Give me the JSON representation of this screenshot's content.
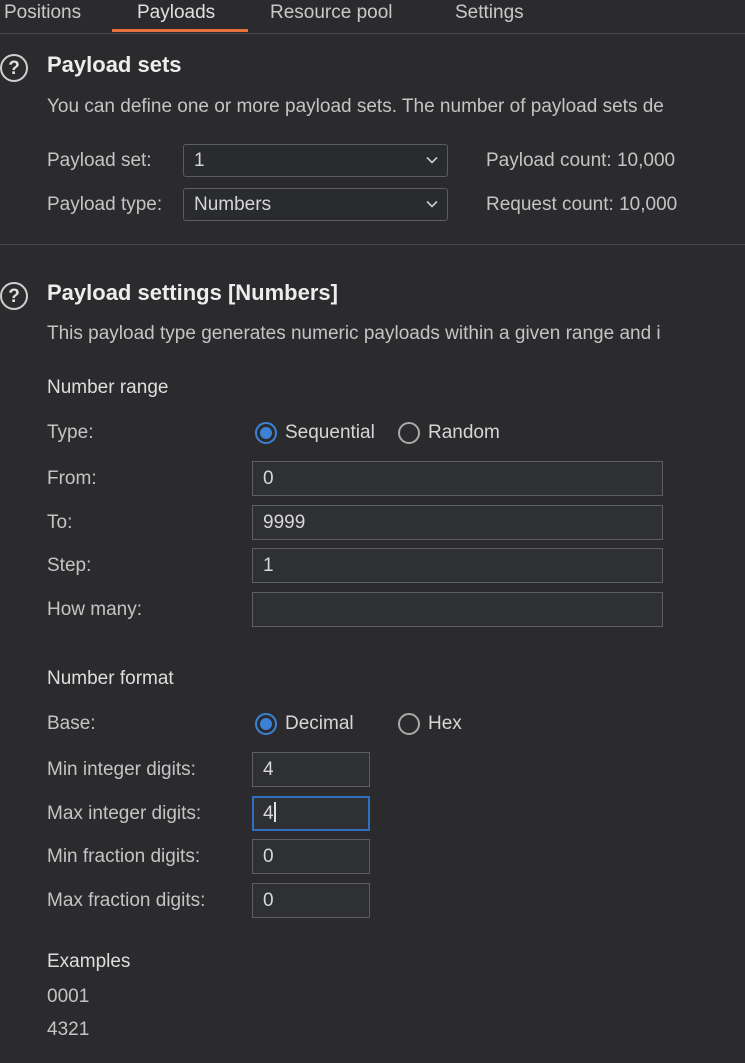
{
  "tabs": [
    {
      "label": "Positions"
    },
    {
      "label": "Payloads"
    },
    {
      "label": "Resource pool"
    },
    {
      "label": "Settings"
    }
  ],
  "payload_sets": {
    "help_glyph": "?",
    "title": "Payload sets",
    "description": "You can define one or more payload sets. The number of payload sets de",
    "set_label": "Payload set:",
    "set_value": "1",
    "type_label": "Payload type:",
    "type_value": "Numbers",
    "payload_count": "Payload count: 10,000",
    "request_count": "Request count: 10,000"
  },
  "payload_settings": {
    "help_glyph": "?",
    "title": "Payload settings [Numbers]",
    "description": "This payload type generates numeric payloads within a given range and i",
    "number_range": {
      "heading": "Number range",
      "type_label": "Type:",
      "sequential": "Sequential",
      "random": "Random",
      "selected": "Sequential",
      "from_label": "From:",
      "from_value": "0",
      "to_label": "To:",
      "to_value": "9999",
      "step_label": "Step:",
      "step_value": "1",
      "how_many_label": "How many:",
      "how_many_value": ""
    },
    "number_format": {
      "heading": "Number format",
      "base_label": "Base:",
      "decimal": "Decimal",
      "hex": "Hex",
      "selected": "Decimal",
      "min_int_label": "Min integer digits:",
      "min_int_value": "4",
      "max_int_label": "Max integer digits:",
      "max_int_value": "4",
      "min_frac_label": "Min fraction digits:",
      "min_frac_value": "0",
      "max_frac_label": "Max fraction digits:",
      "max_frac_value": "0"
    },
    "examples": {
      "heading": "Examples",
      "items": [
        "0001",
        "4321"
      ]
    }
  },
  "colors": {
    "background": "#2b2b2e",
    "accent_tab": "#e8703a",
    "radio_selected": "#3b82d6",
    "focus_border": "#2f6fbf"
  },
  "icons": [
    "help-icon",
    "chevron-down-icon",
    "radio-selected-icon",
    "radio-unselected-icon"
  ]
}
